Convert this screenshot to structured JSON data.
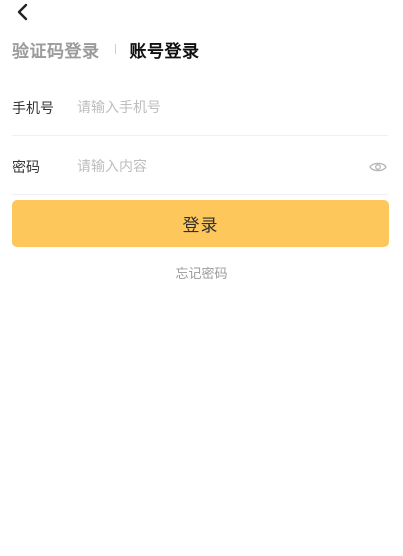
{
  "header": {
    "back_icon": "chevron-left-icon"
  },
  "tabs": [
    {
      "label": "验证码登录",
      "active": false
    },
    {
      "label": "账号登录",
      "active": true
    }
  ],
  "form": {
    "phone": {
      "label": "手机号",
      "placeholder": "请输入手机号",
      "value": ""
    },
    "password": {
      "label": "密码",
      "placeholder": "请输入内容",
      "value": "",
      "toggle_icon": "eye-icon"
    }
  },
  "login_button": {
    "label": "登录"
  },
  "forgot_password": {
    "label": "忘记密码"
  },
  "colors": {
    "accent": "#fec75b",
    "tab_inactive": "#9b9b9b",
    "placeholder": "#bdbdbd"
  }
}
